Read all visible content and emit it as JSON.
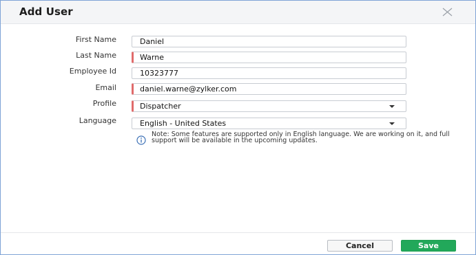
{
  "dialog": {
    "title": "Add User"
  },
  "fields": [
    {
      "label": "First Name",
      "value": "Daniel"
    },
    {
      "label": "Last Name",
      "value": "Warne"
    },
    {
      "label": "Employee Id",
      "value": "10323777"
    },
    {
      "label": "Email",
      "value": "daniel.warne@zylker.com"
    },
    {
      "label": "Profile",
      "value": "Dispatcher"
    },
    {
      "label": "Language",
      "value": "English - United States"
    }
  ],
  "note": {
    "text": "Note: Some features are supported only in English language. We are working on it, and full support will be available in the upcoming updates."
  },
  "footer": {
    "cancel_label": "Cancel",
    "save_label": "Save"
  },
  "colors": {
    "required_marker": "#e06b6b",
    "save_button": "#22a85a",
    "header_bg": "#f4f5f7"
  },
  "icons": {
    "close": "close-icon",
    "info": "info-icon",
    "dropdown": "chevron-down-icon"
  }
}
